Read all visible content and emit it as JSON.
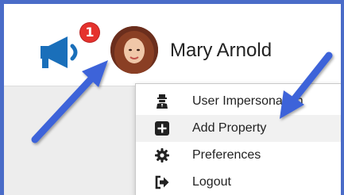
{
  "header": {
    "notification_count": "1",
    "user_name": "Mary Arnold"
  },
  "menu": {
    "items": [
      {
        "label": "User Impersonation",
        "icon": "user-secret-icon"
      },
      {
        "label": "Add Property",
        "icon": "plus-square-icon"
      },
      {
        "label": "Preferences",
        "icon": "gear-icon"
      },
      {
        "label": "Logout",
        "icon": "sign-out-icon"
      }
    ]
  },
  "colors": {
    "border": "#4a6cc8",
    "badge": "#e5322d",
    "megaphone": "#1a6fba",
    "arrow": "#3d63d9",
    "highlight": "#f1f1f1"
  }
}
